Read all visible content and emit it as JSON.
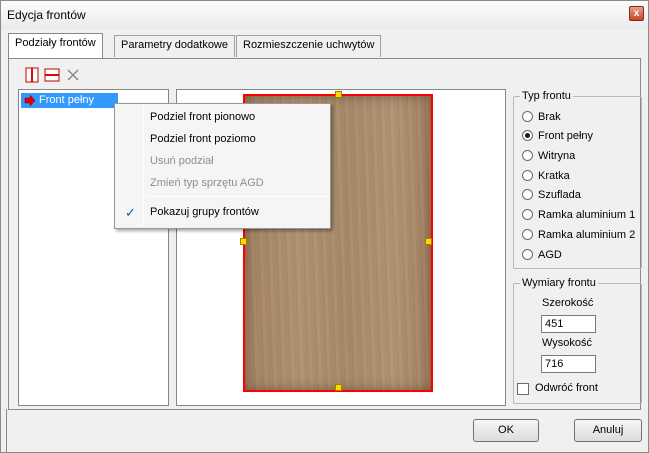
{
  "window": {
    "title": "Edycja frontów",
    "close_glyph": "x"
  },
  "tabs": [
    {
      "label": "Podziały frontów"
    },
    {
      "label": "Parametry dodatkowe"
    },
    {
      "label": "Rozmieszczenie uchwytów"
    }
  ],
  "toolbar": {
    "split_vertical_icon": "split-vertical-icon",
    "split_horizontal_icon": "split-horizontal-icon",
    "delete_icon": "delete-x-icon"
  },
  "tree": {
    "items": [
      {
        "label": "Front pełny",
        "icon": "red-arrow-icon"
      }
    ]
  },
  "context_menu": {
    "items": [
      {
        "label": "Podziel front pionowo",
        "enabled": true
      },
      {
        "label": "Podziel front poziomo",
        "enabled": true
      },
      {
        "label": "Usuń podział",
        "enabled": false
      },
      {
        "label": "Zmień typ sprzętu AGD",
        "enabled": false
      },
      {
        "label": "Pokazuj grupy frontów",
        "enabled": true,
        "checked": true
      }
    ],
    "check_glyph": "✓"
  },
  "front_type": {
    "legend": "Typ frontu",
    "options": [
      {
        "label": "Brak",
        "selected": false
      },
      {
        "label": "Front pełny",
        "selected": true
      },
      {
        "label": "Witryna",
        "selected": false
      },
      {
        "label": "Kratka",
        "selected": false
      },
      {
        "label": "Szuflada",
        "selected": false
      },
      {
        "label": "Ramka aluminium 1",
        "selected": false
      },
      {
        "label": "Ramka aluminium 2",
        "selected": false
      },
      {
        "label": "AGD",
        "selected": false
      }
    ]
  },
  "dimensions": {
    "legend": "Wymiary frontu",
    "width_label": "Szerokość",
    "width_value": "451",
    "height_label": "Wysokość",
    "height_value": "716",
    "flip_label": "Odwróć front",
    "flip_checked": false
  },
  "buttons": {
    "ok": "OK",
    "cancel": "Anuluj"
  },
  "colors": {
    "selection": "#3399ff",
    "front_border": "#ff0000",
    "handle": "#ffd800",
    "wood": "#a88a6a"
  }
}
